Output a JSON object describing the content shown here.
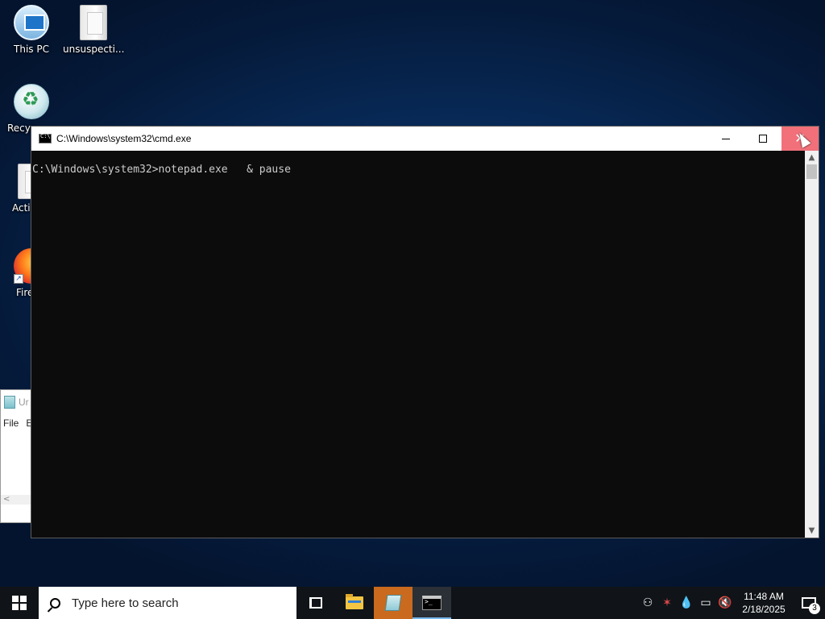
{
  "desktop": {
    "icons": [
      {
        "label": "This PC",
        "icon": "this-pc-icon"
      },
      {
        "label": "unsuspecti...",
        "icon": "file-icon"
      },
      {
        "label": "Recyc",
        "icon": "recycle-bin-icon"
      },
      {
        "label": "Acti",
        "icon": "file-icon"
      },
      {
        "label": "Fire",
        "icon": "firefox-icon"
      }
    ]
  },
  "notepad_window": {
    "title": "Ur",
    "menu": [
      "File",
      "E"
    ],
    "scroll_arrow": "<"
  },
  "cmd_window": {
    "title": "C:\\Windows\\system32\\cmd.exe",
    "console_text": "C:\\Windows\\system32>notepad.exe   & pause",
    "controls": {
      "minimize": "minimize",
      "maximize": "maximize",
      "close": "close"
    },
    "close_hover_color": "#f1707a"
  },
  "taskbar": {
    "search_placeholder": "Type here to search",
    "pinned": [
      "task-view",
      "file-explorer",
      "notepad",
      "command-prompt"
    ],
    "active_app": "command-prompt",
    "clock_time": "11:48 AM",
    "clock_date": "2/18/2025",
    "notification_count": "3"
  },
  "colors": {
    "desktop_bg": "#082c5c",
    "taskbar_bg": "#101418",
    "console_bg": "#0c0c0c",
    "console_fg": "#cccccc",
    "accent": "#76b9ed"
  }
}
